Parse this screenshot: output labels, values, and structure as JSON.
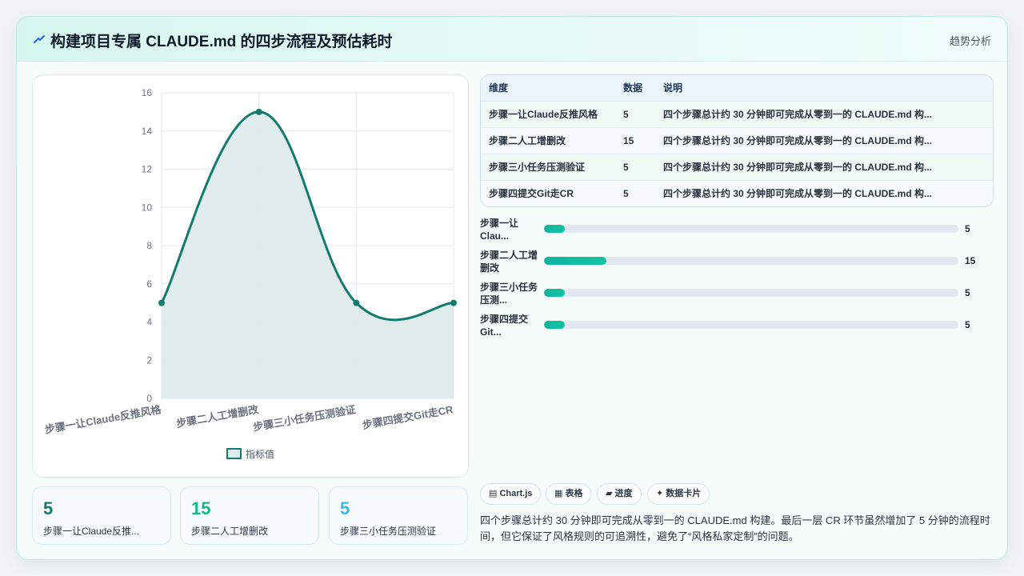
{
  "header": {
    "title": "构建项目专属 CLAUDE.md 的四步流程及预估耗时",
    "tag": "趋势分析"
  },
  "chart_data": {
    "type": "area",
    "categories": [
      "步骤一让Claude反推风格",
      "步骤二人工增删改",
      "步骤三小任务压测验证",
      "步骤四提交Git走CR"
    ],
    "series": [
      {
        "name": "指标值",
        "values": [
          5,
          15,
          5,
          5
        ]
      }
    ],
    "ylim": [
      0,
      16
    ],
    "yticks": [
      0,
      2,
      4,
      6,
      8,
      10,
      12,
      14,
      16
    ],
    "grid": true,
    "legend": "bottom",
    "colors": {
      "line": "#127a6e",
      "fill": "#dde9ea",
      "grid": "#e2e8ee",
      "tick": "#6b7280"
    }
  },
  "stats": [
    {
      "value": "5",
      "label": "步骤一让Claude反推...",
      "color": "#127a6e"
    },
    {
      "value": "15",
      "label": "步骤二人工增删改",
      "color": "#14b88a"
    },
    {
      "value": "5",
      "label": "步骤三小任务压测验证",
      "color": "#3bb6e0"
    }
  ],
  "table": {
    "headers": [
      "维度",
      "数据",
      "说明"
    ],
    "rows": [
      [
        "步骤一让Claude反推风格",
        "5",
        "四个步骤总计约 30 分钟即可完成从零到一的 CLAUDE.md 构..."
      ],
      [
        "步骤二人工增删改",
        "15",
        "四个步骤总计约 30 分钟即可完成从零到一的 CLAUDE.md 构..."
      ],
      [
        "步骤三小任务压测验证",
        "5",
        "四个步骤总计约 30 分钟即可完成从零到一的 CLAUDE.md 构..."
      ],
      [
        "步骤四提交Git走CR",
        "5",
        "四个步骤总计约 30 分钟即可完成从零到一的 CLAUDE.md 构..."
      ]
    ]
  },
  "progress": {
    "max": 100,
    "items": [
      {
        "label1": "步骤一让",
        "label2": "Clau...",
        "value": 5
      },
      {
        "label1": "步骤二人工增",
        "label2": "删改",
        "value": 15
      },
      {
        "label1": "步骤三小任务",
        "label2": "压测...",
        "value": 5
      },
      {
        "label1": "步骤四提交",
        "label2": "Git...",
        "value": 5
      }
    ]
  },
  "chips": [
    "Chart.js",
    "表格",
    "进度",
    "数据卡片"
  ],
  "summary": "四个步骤总计约 30 分钟即可完成从零到一的 CLAUDE.md 构建。最后一层 CR 环节虽然增加了 5 分钟的流程时间，但它保证了风格规则的可追溯性，避免了“风格私家定制”的问题。"
}
